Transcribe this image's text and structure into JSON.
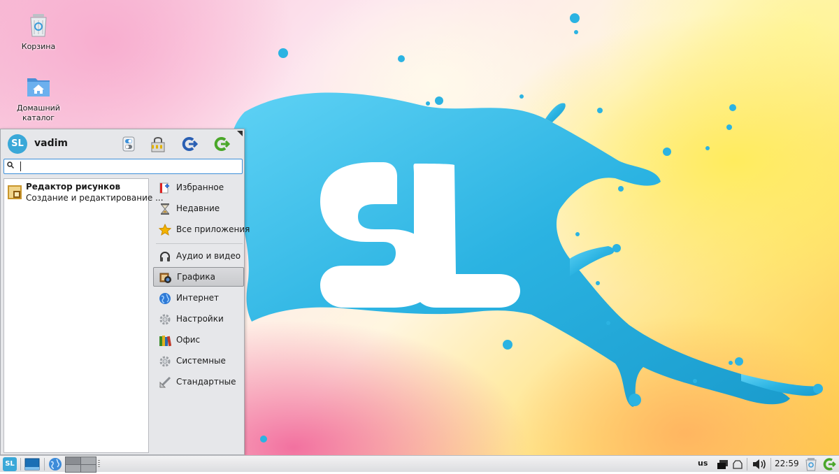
{
  "desktop": {
    "icons": [
      {
        "label": "Корзина"
      },
      {
        "label": "Домашний каталог"
      }
    ],
    "logo_text": "SL",
    "colors": {
      "splash": "#2fb8e4",
      "accent": "#3c8fd8"
    }
  },
  "menu": {
    "avatar_text": "SL",
    "username": "vadim",
    "header_buttons": [
      "settings-toggle-icon",
      "lock-screen-icon",
      "switch-user-icon",
      "logout-icon"
    ],
    "search": {
      "value": "",
      "placeholder": ""
    },
    "results": [
      {
        "title": "Редактор рисунков",
        "subtitle": "Создание и редактирование ..."
      }
    ],
    "categories": [
      {
        "label": "Избранное",
        "icon": "favorites-icon"
      },
      {
        "label": "Недавние",
        "icon": "hourglass-icon"
      },
      {
        "label": "Все приложения",
        "icon": "star-icon"
      },
      {
        "label": "Аудио и видео",
        "icon": "headphones-icon"
      },
      {
        "label": "Графика",
        "icon": "camera-icon",
        "selected": true
      },
      {
        "label": "Интернет",
        "icon": "globe-icon"
      },
      {
        "label": "Настройки",
        "icon": "gear-icon"
      },
      {
        "label": "Офис",
        "icon": "books-icon"
      },
      {
        "label": "Системные",
        "icon": "gear-icon"
      },
      {
        "label": "Стандартные",
        "icon": "ruler-icon"
      }
    ]
  },
  "panel": {
    "start_text": "SL",
    "keyboard_layout": "us",
    "clock": "22:59"
  }
}
